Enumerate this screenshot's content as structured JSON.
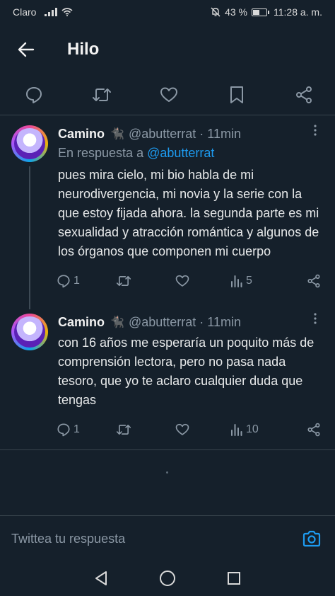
{
  "status": {
    "carrier": "Claro",
    "battery": "43 %",
    "battery_level": 0.43,
    "time": "11:28 a. m."
  },
  "header": {
    "title": "Hilo"
  },
  "icons": {
    "back": "arrow-left-icon",
    "actions": [
      "comment-icon",
      "retweet-icon",
      "heart-icon",
      "bookmark-icon",
      "share-icon"
    ]
  },
  "tweets": [
    {
      "name": "Camino",
      "emoji": "🐈‍⬛",
      "handle": "@abutterrat",
      "separator": "·",
      "time": "11min",
      "reply_prefix": "En respuesta a",
      "reply_mention": "@abutterrat",
      "text": "pues mira cielo, mi bio habla de mi neurodivergencia, mi novia y la serie con la que estoy fijada ahora. la segunda parte es mi sexualidad y atracción romántica y algunos de los órganos que componen mi cuerpo",
      "replies": "1",
      "views": "5"
    },
    {
      "name": "Camino",
      "emoji": "🐈‍⬛",
      "handle": "@abutterrat",
      "separator": "·",
      "time": "11min",
      "text": "con 16 años me esperaría un poquito más de comprensión lectora, pero no pasa nada tesoro, que yo te aclaro cualquier duda que tengas",
      "replies": "1",
      "views": "10"
    }
  ],
  "reply_bar": {
    "placeholder": "Twittea tu respuesta"
  },
  "colors": {
    "background": "#15202b",
    "accent": "#1d9bf0",
    "muted": "#8b98a5",
    "divider": "#38444d"
  }
}
